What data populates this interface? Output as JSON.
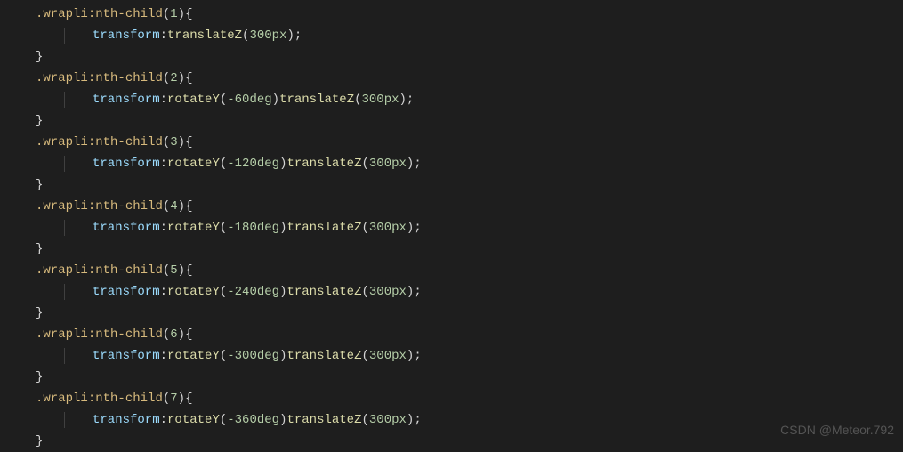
{
  "watermark": "CSDN @Meteor.792",
  "rules": [
    {
      "selector": ".wrap li:nth-child(1)",
      "property": "transform",
      "value_parts": [
        {
          "func": "translateZ",
          "arg": "300px"
        }
      ]
    },
    {
      "selector": ".wrap li:nth-child(2)",
      "property": "transform",
      "value_parts": [
        {
          "func": "rotateY",
          "arg": "-60deg"
        },
        {
          "func": "translateZ",
          "arg": "300px"
        }
      ]
    },
    {
      "selector": ".wrap li:nth-child(3)",
      "property": "transform",
      "value_parts": [
        {
          "func": "rotateY",
          "arg": "-120deg"
        },
        {
          "func": "translateZ",
          "arg": "300px"
        }
      ]
    },
    {
      "selector": ".wrap li:nth-child(4)",
      "property": "transform",
      "value_parts": [
        {
          "func": "rotateY",
          "arg": "-180deg"
        },
        {
          "func": "translateZ",
          "arg": "300px"
        }
      ]
    },
    {
      "selector": ".wrap li:nth-child(5)",
      "property": "transform",
      "value_parts": [
        {
          "func": "rotateY",
          "arg": "-240deg"
        },
        {
          "func": "translateZ",
          "arg": "300px"
        }
      ]
    },
    {
      "selector": ".wrap li:nth-child(6)",
      "property": "transform",
      "value_parts": [
        {
          "func": "rotateY",
          "arg": "-300deg"
        },
        {
          "func": "translateZ",
          "arg": "300px"
        }
      ]
    },
    {
      "selector": ".wrap li:nth-child(7)",
      "property": "transform",
      "value_parts": [
        {
          "func": "rotateY",
          "arg": "-360deg"
        },
        {
          "func": "translateZ",
          "arg": "300px"
        }
      ]
    }
  ],
  "tokens": {
    "open_brace": "{",
    "close_brace": "}",
    "colon": ":",
    "semicolon": ";",
    "open_paren": "(",
    "close_paren": ")"
  }
}
